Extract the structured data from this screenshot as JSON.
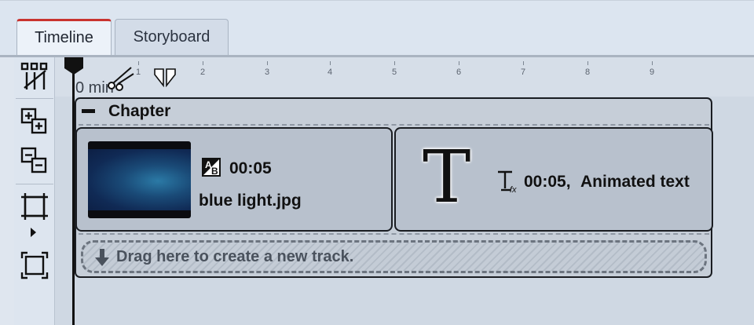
{
  "tabs": [
    {
      "label": "Timeline",
      "active": true
    },
    {
      "label": "Storyboard",
      "active": false
    }
  ],
  "toolbar": {
    "icons": [
      "track-split-icon",
      "add-track-icon",
      "remove-track-icon",
      "expand-icon",
      "fit-icon"
    ]
  },
  "ruler": {
    "zero_label": "0 min",
    "ticks": [
      "1",
      "2",
      "3",
      "4",
      "5",
      "6",
      "7",
      "8",
      "9"
    ]
  },
  "chapter": {
    "title": "Chapter",
    "clips": [
      {
        "duration": "00:05",
        "name": "blue light.jpg",
        "icon": "image-transition-icon"
      },
      {
        "duration": "00:05,",
        "name": "Animated text",
        "icon": "text-effect-icon"
      }
    ],
    "new_track": "Drag here to create a new track."
  },
  "colors": {
    "active_tab_accent": "#c9332f",
    "workspace": "#cfd8e3"
  }
}
